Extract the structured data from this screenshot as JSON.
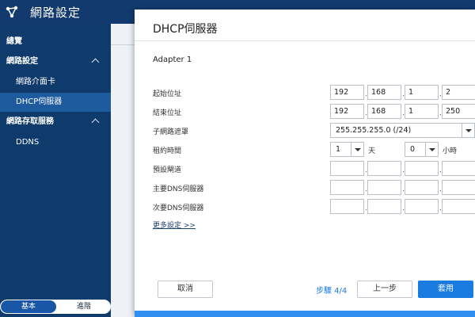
{
  "app": {
    "title": "網路設定",
    "icon": "network-settings-icon"
  },
  "sidebar": {
    "items": [
      {
        "label": "總覽",
        "type": "section"
      },
      {
        "label": "網路設定",
        "type": "section",
        "expanded": true
      },
      {
        "label": "網路介面卡",
        "type": "sub"
      },
      {
        "label": "DHCP伺服器",
        "type": "sub",
        "active": true
      },
      {
        "label": "網路存取服務",
        "type": "section",
        "expanded": true
      },
      {
        "label": "DDNS",
        "type": "sub"
      }
    ],
    "mode": {
      "basic": "基本",
      "advanced": "進階",
      "selected": "基本"
    }
  },
  "dialog": {
    "title": "DHCP伺服器",
    "adapter_title": "Adapter 1",
    "start_ip": {
      "label": "起始位址",
      "octets": [
        "192",
        "168",
        "1",
        "2"
      ]
    },
    "end_ip": {
      "label": "結束位址",
      "octets": [
        "192",
        "168",
        "1",
        "250"
      ]
    },
    "subnet": {
      "label": "子網路遮罩",
      "value": "255.255.255.0 (/24)"
    },
    "lease": {
      "label": "租約時間",
      "days": "1",
      "days_unit": "天",
      "hours": "0",
      "hours_unit": "小時"
    },
    "gateway": {
      "label": "預設閘道",
      "octets": [
        "",
        "",
        "",
        ""
      ]
    },
    "primary_dns": {
      "label": "主要DNS伺服器",
      "octets": [
        "",
        "",
        "",
        ""
      ]
    },
    "secondary_dns": {
      "label": "次要DNS伺服器",
      "octets": [
        "",
        "",
        "",
        ""
      ]
    },
    "more_link": "更多設定 >>",
    "cancel_label": "取消",
    "step_text": "步驟 4/4",
    "back_label": "上一步",
    "apply_label": "套用"
  },
  "colors": {
    "topbar": "#123a6e",
    "sidebar": "#0f3a6c",
    "sidebar_active": "#1e5a9e",
    "primary": "#1a7be0",
    "progress": "#2f8ef0"
  }
}
